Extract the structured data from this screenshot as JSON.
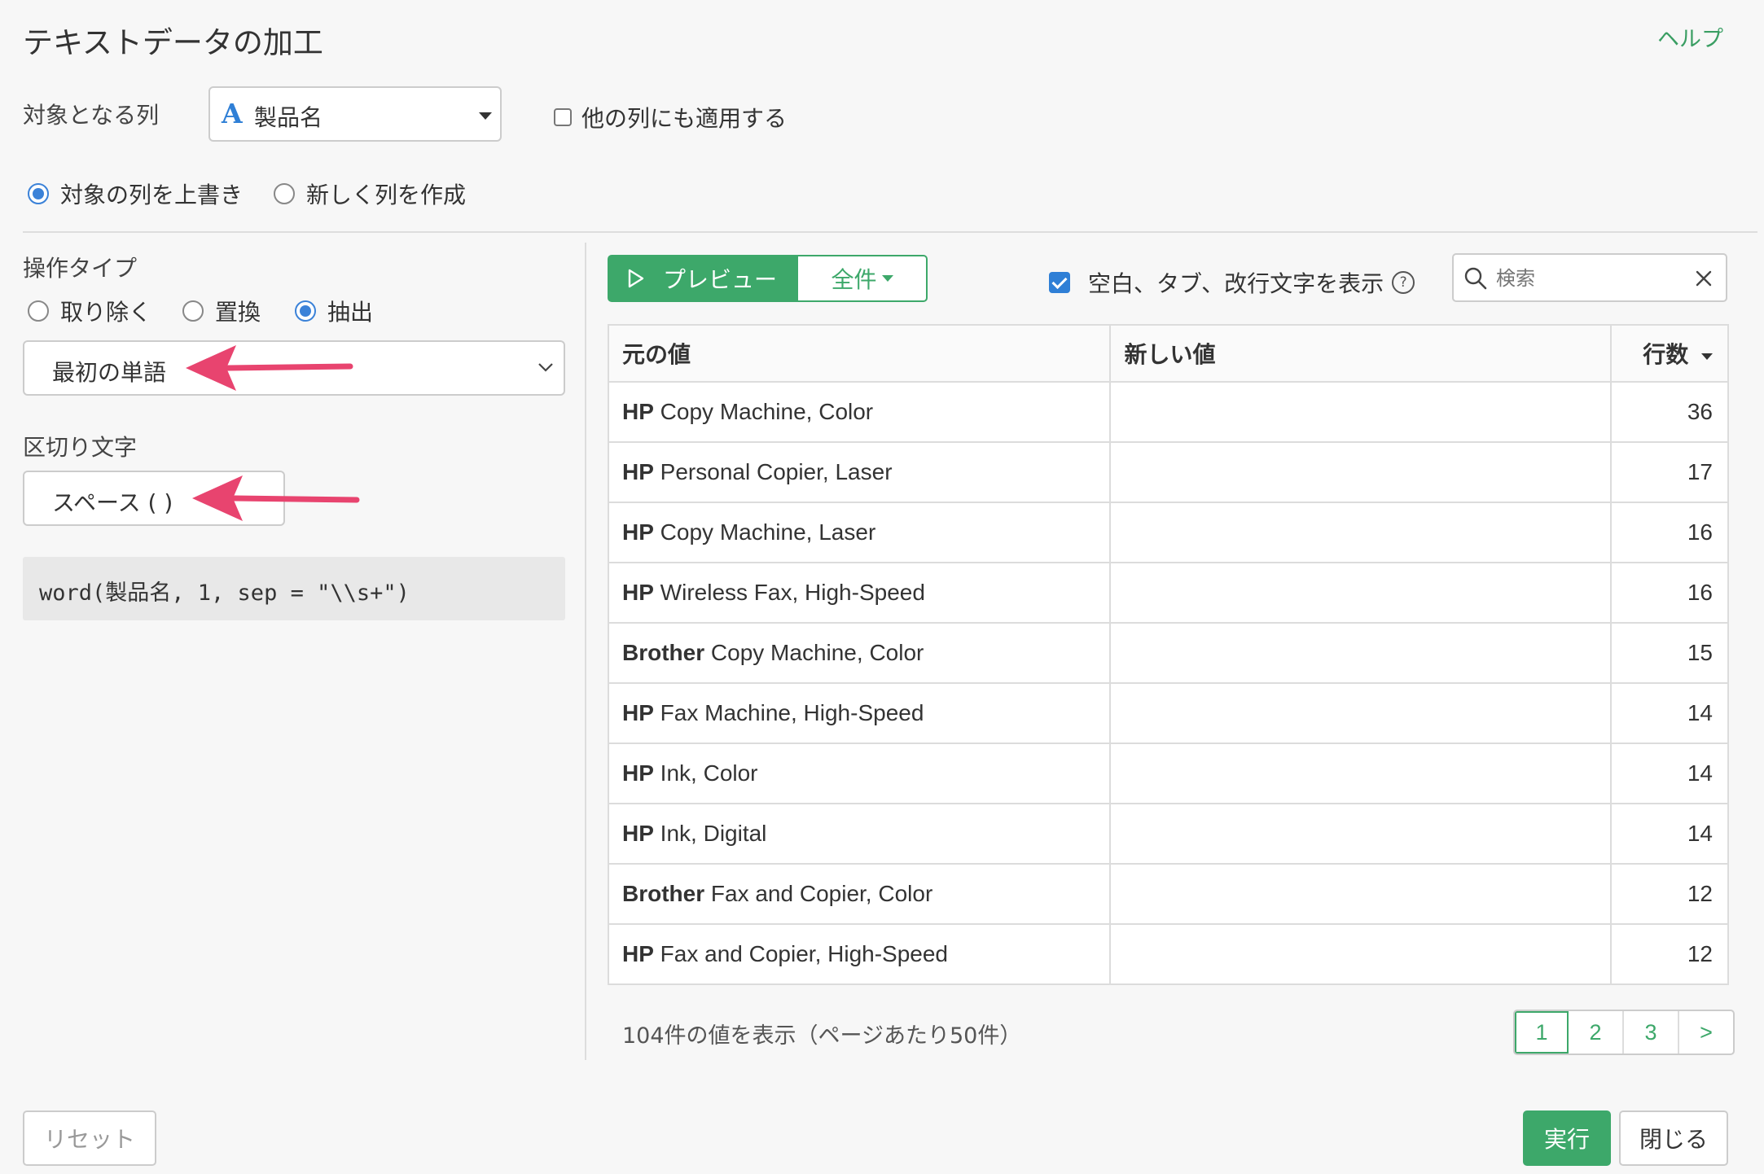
{
  "dialog": {
    "title": "テキストデータの加工",
    "help_link": "ヘルプ"
  },
  "target_column": {
    "label": "対象となる列",
    "type_glyph": "A",
    "selected": "製品名",
    "apply_other_label": "他の列にも適用する",
    "apply_other_checked": false
  },
  "output_mode": {
    "overwrite_label": "対象の列を上書き",
    "new_column_label": "新しく列を作成",
    "selected": "overwrite"
  },
  "operation": {
    "label": "操作タイプ",
    "options": [
      "取り除く",
      "置換",
      "抽出"
    ],
    "selected": "抽出",
    "method_selected": "最初の単語"
  },
  "delimiter": {
    "label": "区切り文字",
    "selected": "スペース ( )"
  },
  "expression": "word(製品名, 1, sep = \"\\\\s+\")",
  "toolbar": {
    "preview_label": "プレビュー",
    "all_label": "全件",
    "show_whitespace_label": "空白、タブ、改行文字を表示",
    "show_whitespace_checked": true,
    "search_placeholder": "検索"
  },
  "table": {
    "headers": [
      "元の値",
      "新しい値",
      "行数"
    ],
    "rows": [
      {
        "bold": "HP",
        "rest": " Copy Machine, Color",
        "new": "",
        "count": "36"
      },
      {
        "bold": "HP",
        "rest": " Personal Copier, Laser",
        "new": "",
        "count": "17"
      },
      {
        "bold": "HP",
        "rest": " Copy Machine, Laser",
        "new": "",
        "count": "16"
      },
      {
        "bold": "HP",
        "rest": " Wireless Fax, High-Speed",
        "new": "",
        "count": "16"
      },
      {
        "bold": "Brother",
        "rest": " Copy Machine, Color",
        "new": "",
        "count": "15"
      },
      {
        "bold": "HP",
        "rest": " Fax Machine, High-Speed",
        "new": "",
        "count": "14"
      },
      {
        "bold": "HP",
        "rest": " Ink, Color",
        "new": "",
        "count": "14"
      },
      {
        "bold": "HP",
        "rest": " Ink, Digital",
        "new": "",
        "count": "14"
      },
      {
        "bold": "Brother",
        "rest": " Fax and Copier, Color",
        "new": "",
        "count": "12"
      },
      {
        "bold": "HP",
        "rest": " Fax and Copier, High-Speed",
        "new": "",
        "count": "12"
      }
    ]
  },
  "footer": {
    "summary": "104件の値を表示（ページあたり50件）",
    "pages": [
      "1",
      "2",
      "3",
      ">"
    ],
    "current_page": "1",
    "reset_label": "リセット",
    "run_label": "実行",
    "close_label": "閉じる"
  },
  "colors": {
    "accent_green": "#3da86a",
    "radio_blue": "#3b82d8",
    "annotation_arrow": "#e8446f"
  }
}
